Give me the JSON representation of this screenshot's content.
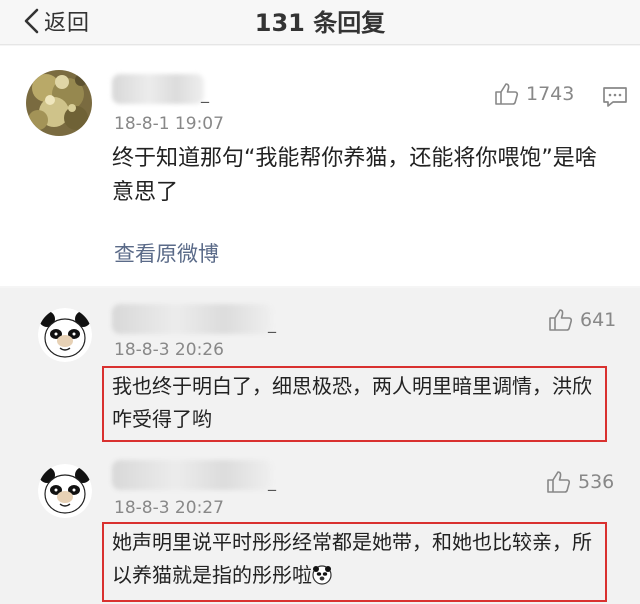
{
  "header": {
    "back_label": "返回",
    "title": "131 条回复"
  },
  "main_post": {
    "username_suffix": "_",
    "timestamp": "18-8-1 19:07",
    "likes": "1743",
    "text": "终于知道那句“我能帮你养猫，还能将你喂饱”是啥意思了",
    "view_original": "查看原微博"
  },
  "replies": [
    {
      "username_suffix": "_",
      "timestamp": "18-8-3 20:26",
      "likes": "641",
      "text": "我也终于明白了，细思极恐，两人明里暗里调情，洪欣咋受得了哟"
    },
    {
      "username_suffix": "_",
      "timestamp": "18-8-3 20:27",
      "likes": "536",
      "text": "她声明里说平时彤彤经常都是她带，和她也比较亲，所以养猫就是指的彤彤啦"
    }
  ],
  "colors": {
    "highlight_border": "#d9312f",
    "link": "#5a6a88",
    "meta": "#888888"
  },
  "icons": {
    "back": "chevron-left-icon",
    "like": "thumbs-up-icon",
    "comment": "comment-icon",
    "emoji": "panda-face-emoji"
  }
}
